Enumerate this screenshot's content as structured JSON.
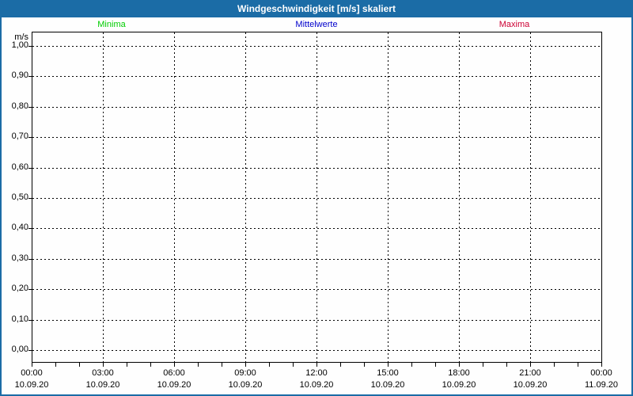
{
  "window": {
    "title": "Windgeschwindigkeit [m/s] skaliert"
  },
  "legend": {
    "items": [
      {
        "label": "Minima",
        "color": "#00cc00"
      },
      {
        "label": "Mittelwerte",
        "color": "#0000cc"
      },
      {
        "label": "Maxima",
        "color": "#cc0033"
      }
    ]
  },
  "chart_data": {
    "type": "line",
    "title": "Windgeschwindigkeit [m/s] skaliert",
    "ylabel": "m/s",
    "ylim": [
      0.0,
      1.0
    ],
    "y_tick_step": 0.1,
    "y_ticks": [
      {
        "label": "1,00",
        "value": 1.0
      },
      {
        "label": "0,90",
        "value": 0.9
      },
      {
        "label": "0,80",
        "value": 0.8
      },
      {
        "label": "0,70",
        "value": 0.7
      },
      {
        "label": "0,60",
        "value": 0.6
      },
      {
        "label": "0,50",
        "value": 0.5
      },
      {
        "label": "0,40",
        "value": 0.4
      },
      {
        "label": "0,30",
        "value": 0.3
      },
      {
        "label": "0,20",
        "value": 0.2
      },
      {
        "label": "0,10",
        "value": 0.1
      },
      {
        "label": "0,00",
        "value": 0.0
      }
    ],
    "x_axis": {
      "major_interval_hours": 3,
      "minor_interval_hours": 1,
      "span_hours": 24
    },
    "x_ticks": [
      {
        "time": "00:00",
        "date": "10.09.20"
      },
      {
        "time": "03:00",
        "date": "10.09.20"
      },
      {
        "time": "06:00",
        "date": "10.09.20"
      },
      {
        "time": "09:00",
        "date": "10.09.20"
      },
      {
        "time": "12:00",
        "date": "10.09.20"
      },
      {
        "time": "15:00",
        "date": "10.09.20"
      },
      {
        "time": "18:00",
        "date": "10.09.20"
      },
      {
        "time": "21:00",
        "date": "10.09.20"
      },
      {
        "time": "00:00",
        "date": "11.09.20"
      }
    ],
    "grid": {
      "style": "dashed",
      "horizontal": true,
      "vertical": true
    },
    "legend_position": "top",
    "series": [
      {
        "name": "Minima",
        "color": "#00cc00",
        "values": []
      },
      {
        "name": "Mittelwerte",
        "color": "#0000cc",
        "values": []
      },
      {
        "name": "Maxima",
        "color": "#cc0033",
        "values": []
      }
    ]
  }
}
